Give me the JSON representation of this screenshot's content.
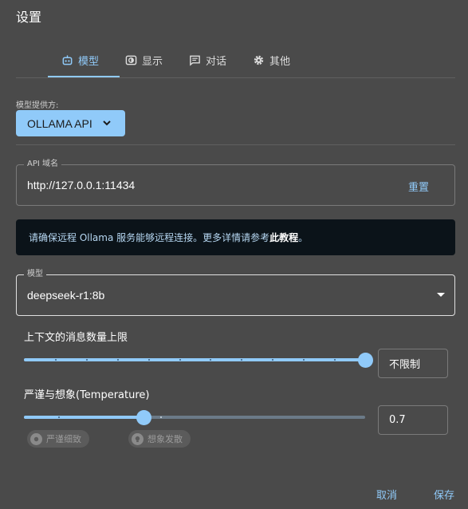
{
  "dialog": {
    "title": "设置"
  },
  "tabs": [
    {
      "label": "模型",
      "icon": "robot-icon",
      "active": true
    },
    {
      "label": "显示",
      "icon": "display-icon",
      "active": false
    },
    {
      "label": "对话",
      "icon": "chat-icon",
      "active": false
    },
    {
      "label": "其他",
      "icon": "gear-icon",
      "active": false
    }
  ],
  "provider": {
    "label": "模型提供方:",
    "value": "OLLAMA API"
  },
  "api": {
    "legend": "API 域名",
    "value": "http://127.0.0.1:11434",
    "reset_label": "重置"
  },
  "info": {
    "text": "请确保远程 Ollama 服务能够远程连接。更多详情请参考",
    "link": "此教程",
    "suffix": "。"
  },
  "model": {
    "legend": "模型",
    "value": "deepseek-r1:8b"
  },
  "context_limit": {
    "label": "上下文的消息数量上限",
    "value_text": "不限制",
    "level": 1.0
  },
  "temperature": {
    "label": "严谨与想象(Temperature)",
    "value": "0.7",
    "level": 0.35,
    "chip_precise": "严谨细致",
    "chip_imaginative": "想象发散"
  },
  "footer": {
    "cancel": "取消",
    "save": "保存"
  },
  "colors": {
    "accent": "#90caf9",
    "background": "#4a4a4a"
  }
}
